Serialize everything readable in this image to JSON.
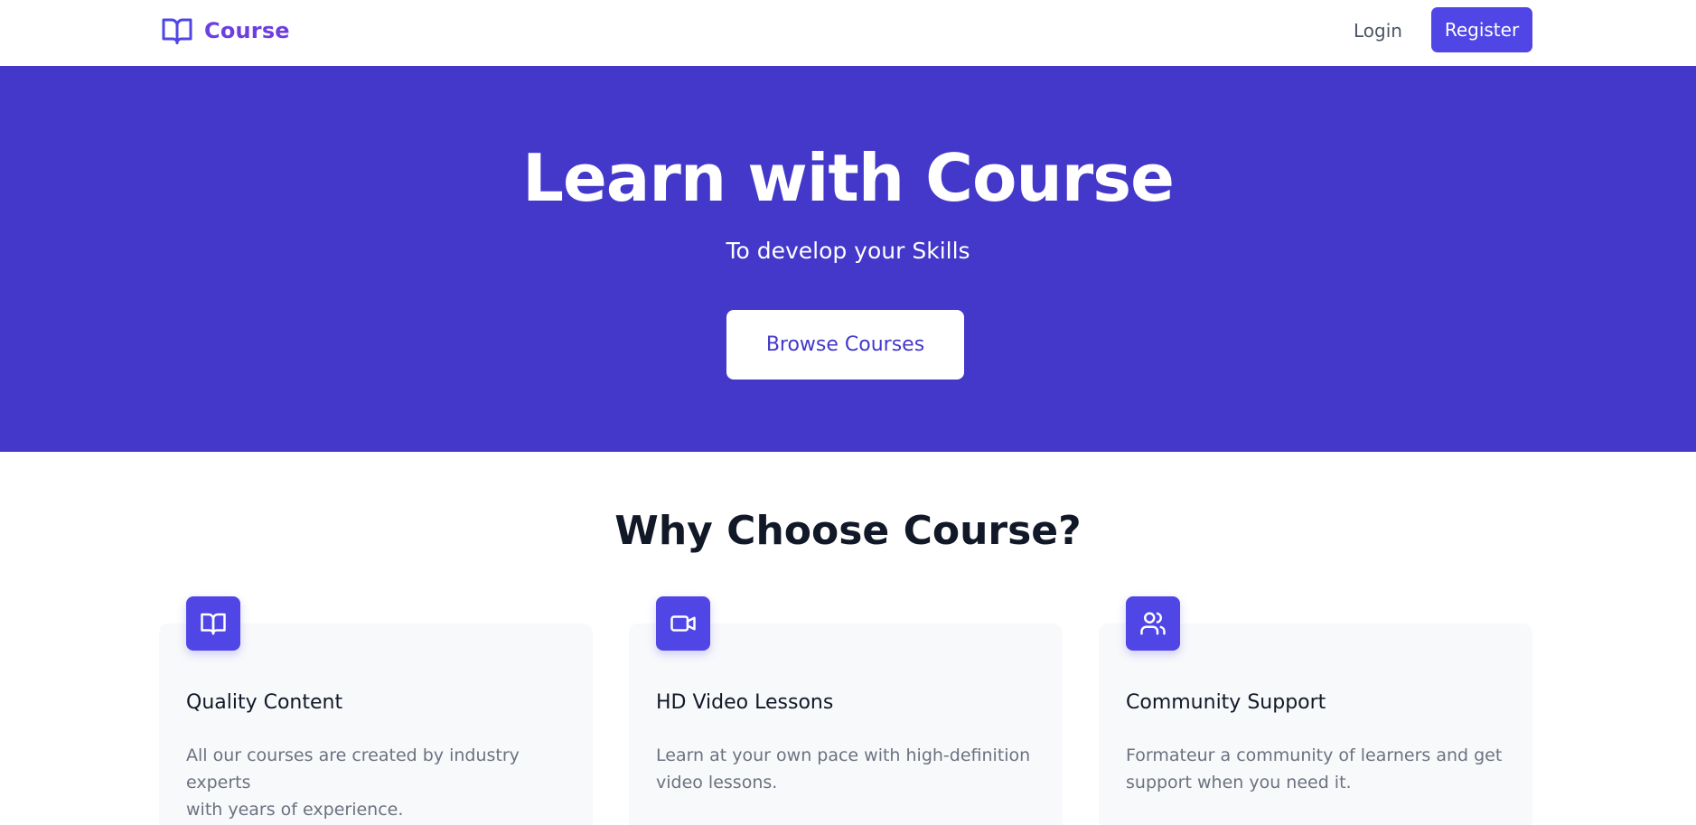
{
  "navbar": {
    "brand": "Course",
    "brand_icon": "open-book-icon",
    "login_label": "Login",
    "register_label": "Register"
  },
  "hero": {
    "title": "Learn with Course",
    "subtitle": "To develop your Skills",
    "cta_label": "Browse Courses"
  },
  "features": {
    "title": "Why Choose Course?",
    "items": [
      {
        "icon": "book-icon",
        "title": "Quality Content",
        "line1": "All our courses are created by industry experts",
        "line2": "with years of experience."
      },
      {
        "icon": "video-camera-icon",
        "title": "HD Video Lessons",
        "line1": "Learn at your own pace with high-definition",
        "line2": "video lessons."
      },
      {
        "icon": "users-icon",
        "title": "Community Support",
        "line1": "Formateur a community of learners and get",
        "line2": "support when you need it."
      }
    ]
  },
  "colors": {
    "primary": "#4f46e5",
    "hero_bg": "#4338ca",
    "brand_text": "#6d3fe0",
    "card_bg": "#f8f9fb"
  }
}
